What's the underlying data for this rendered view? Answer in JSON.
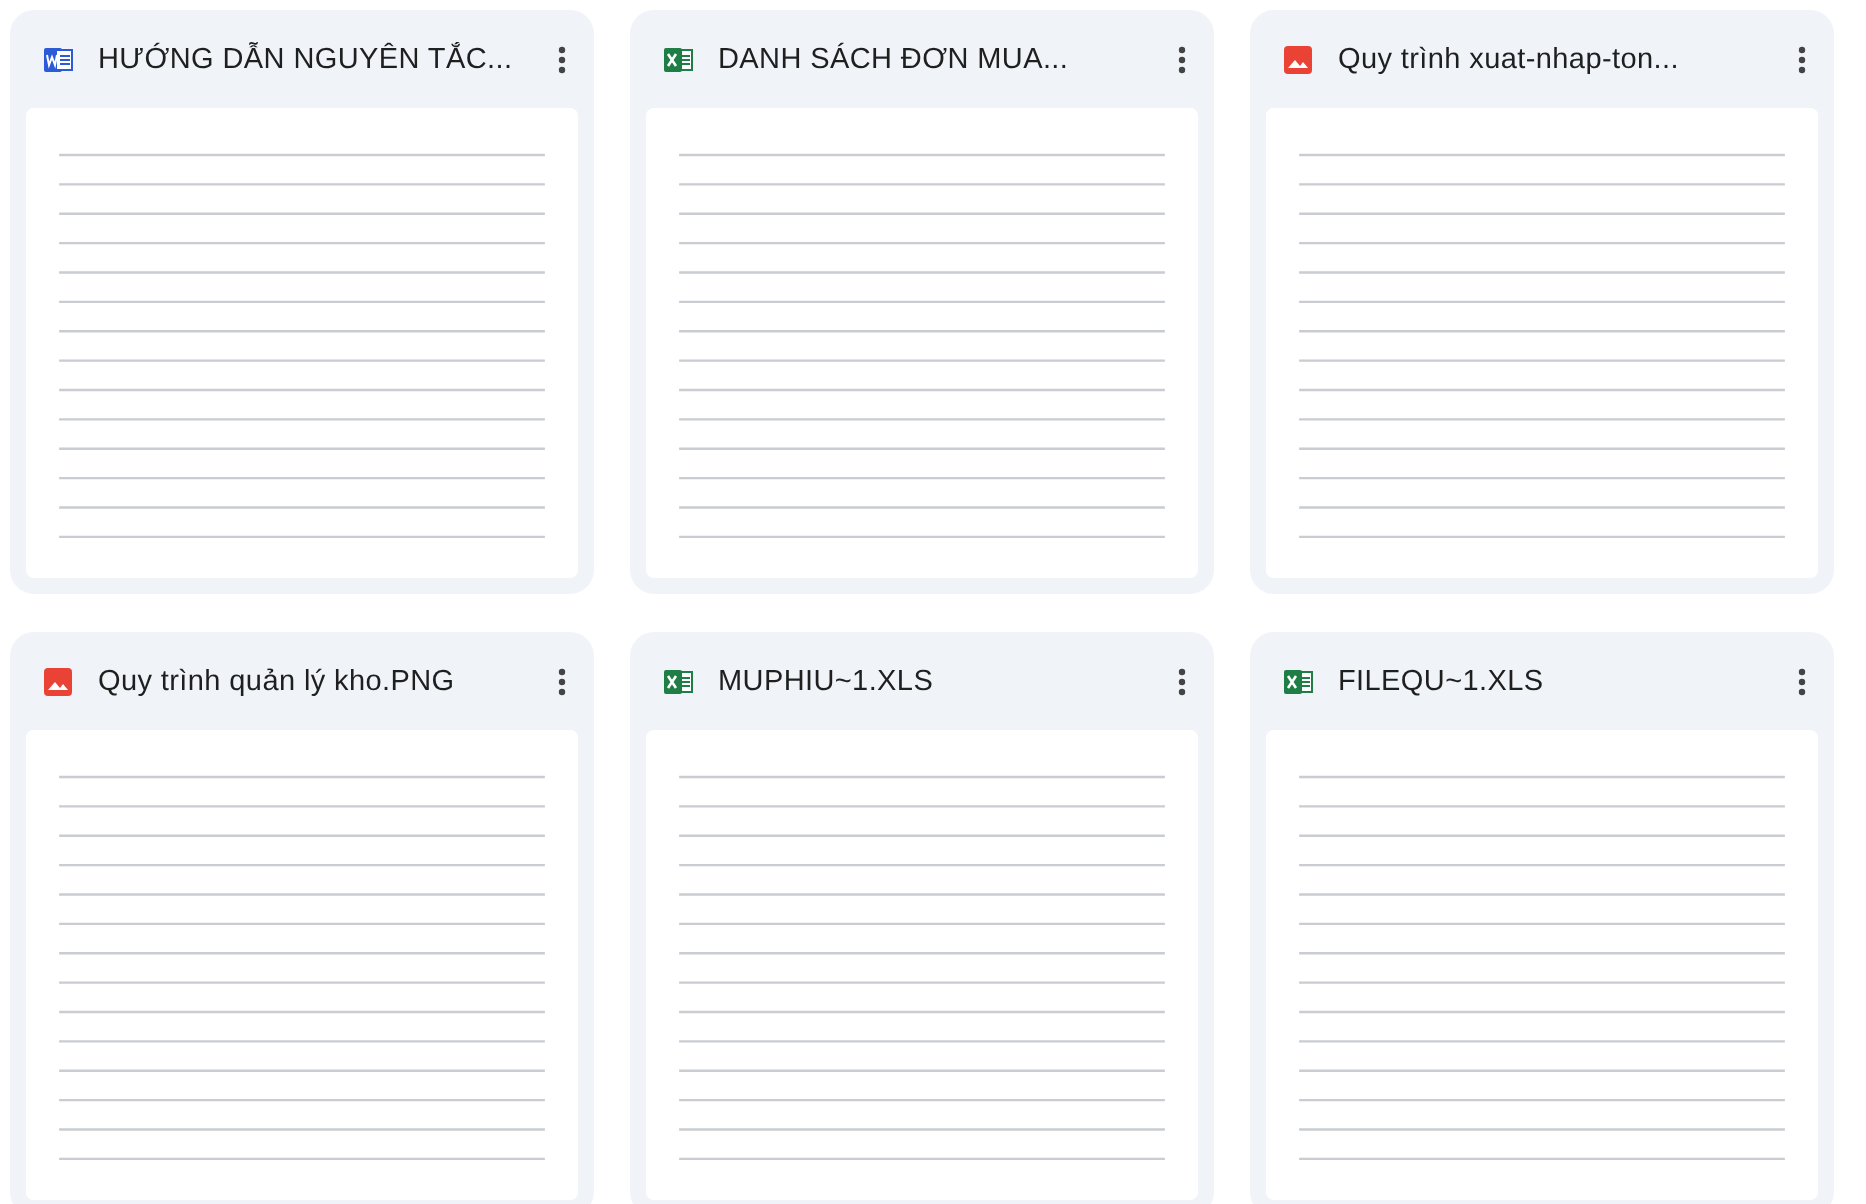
{
  "files": [
    {
      "kind": "word",
      "name": "HƯỚNG DẪN NGUYÊN TẮC..."
    },
    {
      "kind": "excel",
      "name": "DANH SÁCH ĐƠN MUA..."
    },
    {
      "kind": "image",
      "name": "Quy trình xuat-nhap-ton..."
    },
    {
      "kind": "image",
      "name": "Quy trình quản lý kho.PNG"
    },
    {
      "kind": "excel",
      "name": "MUPHIU~1.XLS"
    },
    {
      "kind": "excel",
      "name": "FILEQU~1.XLS"
    }
  ]
}
